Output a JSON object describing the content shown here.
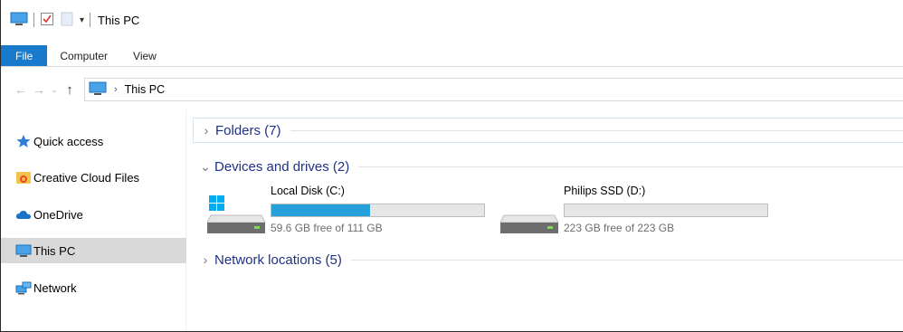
{
  "titlebar": {
    "title": "This PC"
  },
  "ribbon": {
    "tabs": [
      {
        "label": "File"
      },
      {
        "label": "Computer"
      },
      {
        "label": "View"
      }
    ]
  },
  "address": {
    "crumbs": [
      "This PC"
    ]
  },
  "sidebar": {
    "items": [
      {
        "label": "Quick access",
        "icon": "star-icon"
      },
      {
        "label": "Creative Cloud Files",
        "icon": "creative-cloud-folder-icon"
      },
      {
        "label": "OneDrive",
        "icon": "cloud-icon"
      },
      {
        "label": "This PC",
        "icon": "monitor-icon",
        "selected": true
      },
      {
        "label": "Network",
        "icon": "network-icon"
      }
    ]
  },
  "groups": [
    {
      "label": "Folders (7)",
      "expanded": false
    },
    {
      "label": "Devices and drives (2)",
      "expanded": true
    },
    {
      "label": "Network locations (5)",
      "expanded": false
    }
  ],
  "drives": [
    {
      "name": "Local Disk (C:)",
      "free_text": "59.6 GB free of 111 GB",
      "used_fraction": 0.463,
      "icon": "windows-drive-icon"
    },
    {
      "name": "Philips SSD (D:)",
      "free_text": "223 GB free of 223 GB",
      "used_fraction": 0.0,
      "icon": "drive-icon"
    }
  ],
  "colors": {
    "accent": "#1979ca",
    "bar_fill": "#26a0da",
    "group_text": "#1e3287",
    "selection": "#d9d9d9"
  }
}
